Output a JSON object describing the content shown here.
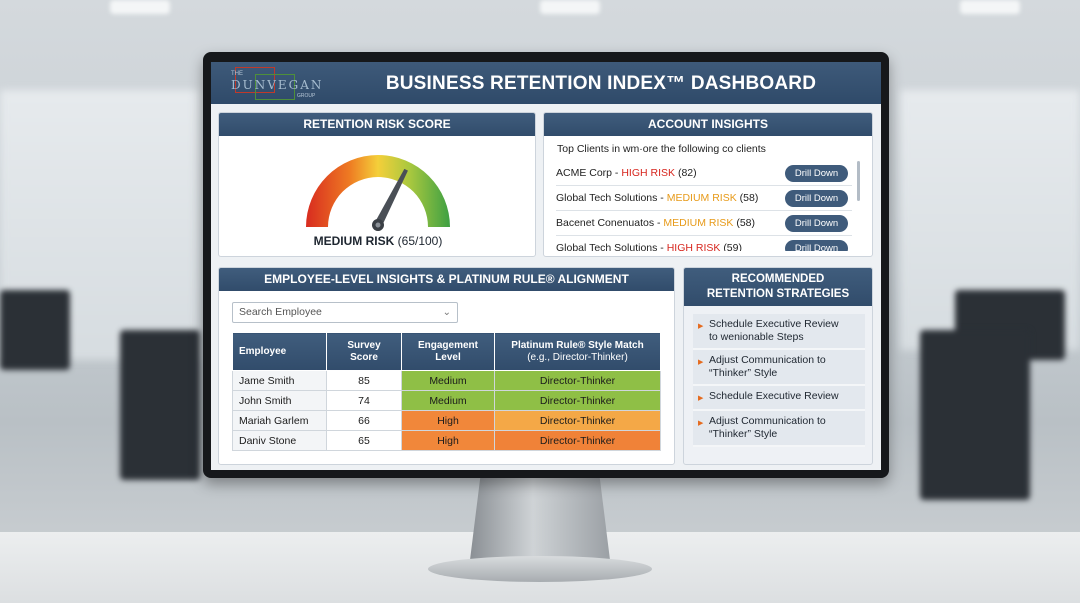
{
  "dashboard": {
    "title": "BUSINESS RETENTION INDEX™ DASHBOARD",
    "logo": {
      "the": "THE",
      "name": "DUNVEGAN",
      "group": "GROUP"
    }
  },
  "risk": {
    "heading": "RETENTION RISK SCORE",
    "label": "MEDIUM RISK",
    "score_text": "(65/100)",
    "score": 65,
    "max": 100
  },
  "accounts": {
    "heading": "ACCOUNT INSIGHTS",
    "intro": "Top Clients in wm·ore the following co clients",
    "rows": [
      {
        "name": "ACME Corp - ",
        "risk": "HIGH RISK",
        "level": "high",
        "score": "(82)",
        "button": "Drill Down"
      },
      {
        "name": "Global Tech Solutions - ",
        "risk": "MEDIUM RISK",
        "level": "medium",
        "score": "(58)",
        "button": "Drill Down"
      },
      {
        "name": "Bacenet Conenuatos - ",
        "risk": "MEDIUM RISK",
        "level": "medium",
        "score": "(58)",
        "button": "Drill Down"
      },
      {
        "name": "Global Tech Solutions - ",
        "risk": "HIGH RISK",
        "level": "high",
        "score": "(59)",
        "button": "Drill Down"
      }
    ]
  },
  "employees": {
    "heading": "EMPLOYEE-LEVEL INSIGHTS & PLATINUM RULE® ALIGNMENT",
    "search_placeholder": "Search Employee",
    "columns": {
      "employee": "Employee",
      "survey_1": "Survey",
      "survey_2": "Score",
      "engagement_1": "Engagement",
      "engagement_2": "Level",
      "platinum_1": "Platinum Rule® Style Match",
      "platinum_2": "(e.g., Director-Thinker)"
    },
    "rows": [
      {
        "name": "Jame Smith",
        "score": "85",
        "engagement": "Medium",
        "style": "Director-Thinker"
      },
      {
        "name": "John Smith",
        "score": "74",
        "engagement": "Medium",
        "style": "Director-Thinker"
      },
      {
        "name": "Mariah Garlem",
        "score": "66",
        "engagement": "High",
        "style": "Director-Thinker"
      },
      {
        "name": "Daniv Stone",
        "score": "65",
        "engagement": "High",
        "style": "Director-Thinker"
      }
    ]
  },
  "strategies": {
    "heading_1": "RECOMMENDED",
    "heading_2": "RETENTION STRATEGIES",
    "items": [
      {
        "line1": "Schedule Executive Review",
        "line2": "to wenionable Steps"
      },
      {
        "line1": "Adjust Communication to",
        "line2": "“Thinker” Style"
      },
      {
        "line1": "Schedule Executive Review",
        "line2": ""
      },
      {
        "line1": "Adjust Communication to",
        "line2": "“Thinker” Style"
      }
    ]
  },
  "colors": {
    "header": "#314c6b",
    "high_risk": "#d7261e",
    "medium_risk": "#e79a19",
    "engagement_medium": "#8fbf46",
    "engagement_high": "#f1873a"
  },
  "icons": [
    "chevron-down-icon",
    "bullet-arrow-icon",
    "gauge-needle-icon"
  ]
}
